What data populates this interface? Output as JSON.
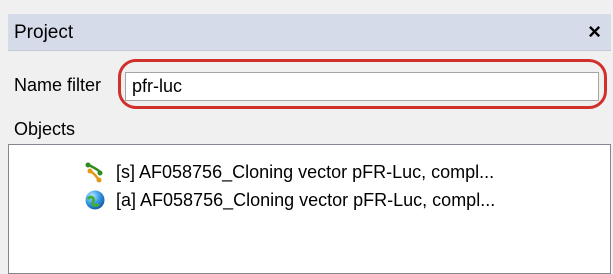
{
  "panel": {
    "title": "Project",
    "close_glyph": "×"
  },
  "filter": {
    "label": "Name filter",
    "value": "pfr-luc"
  },
  "objects": {
    "label": "Objects",
    "items": [
      {
        "text": "[s] AF058756_Cloning vector pFR-Luc, compl...",
        "icon": "sequence-icon"
      },
      {
        "text": "[a] AF058756_Cloning vector pFR-Luc, compl...",
        "icon": "annotation-icon"
      }
    ]
  },
  "colors": {
    "titlebar": "#d6dbe9",
    "highlight": "#d0312d"
  }
}
